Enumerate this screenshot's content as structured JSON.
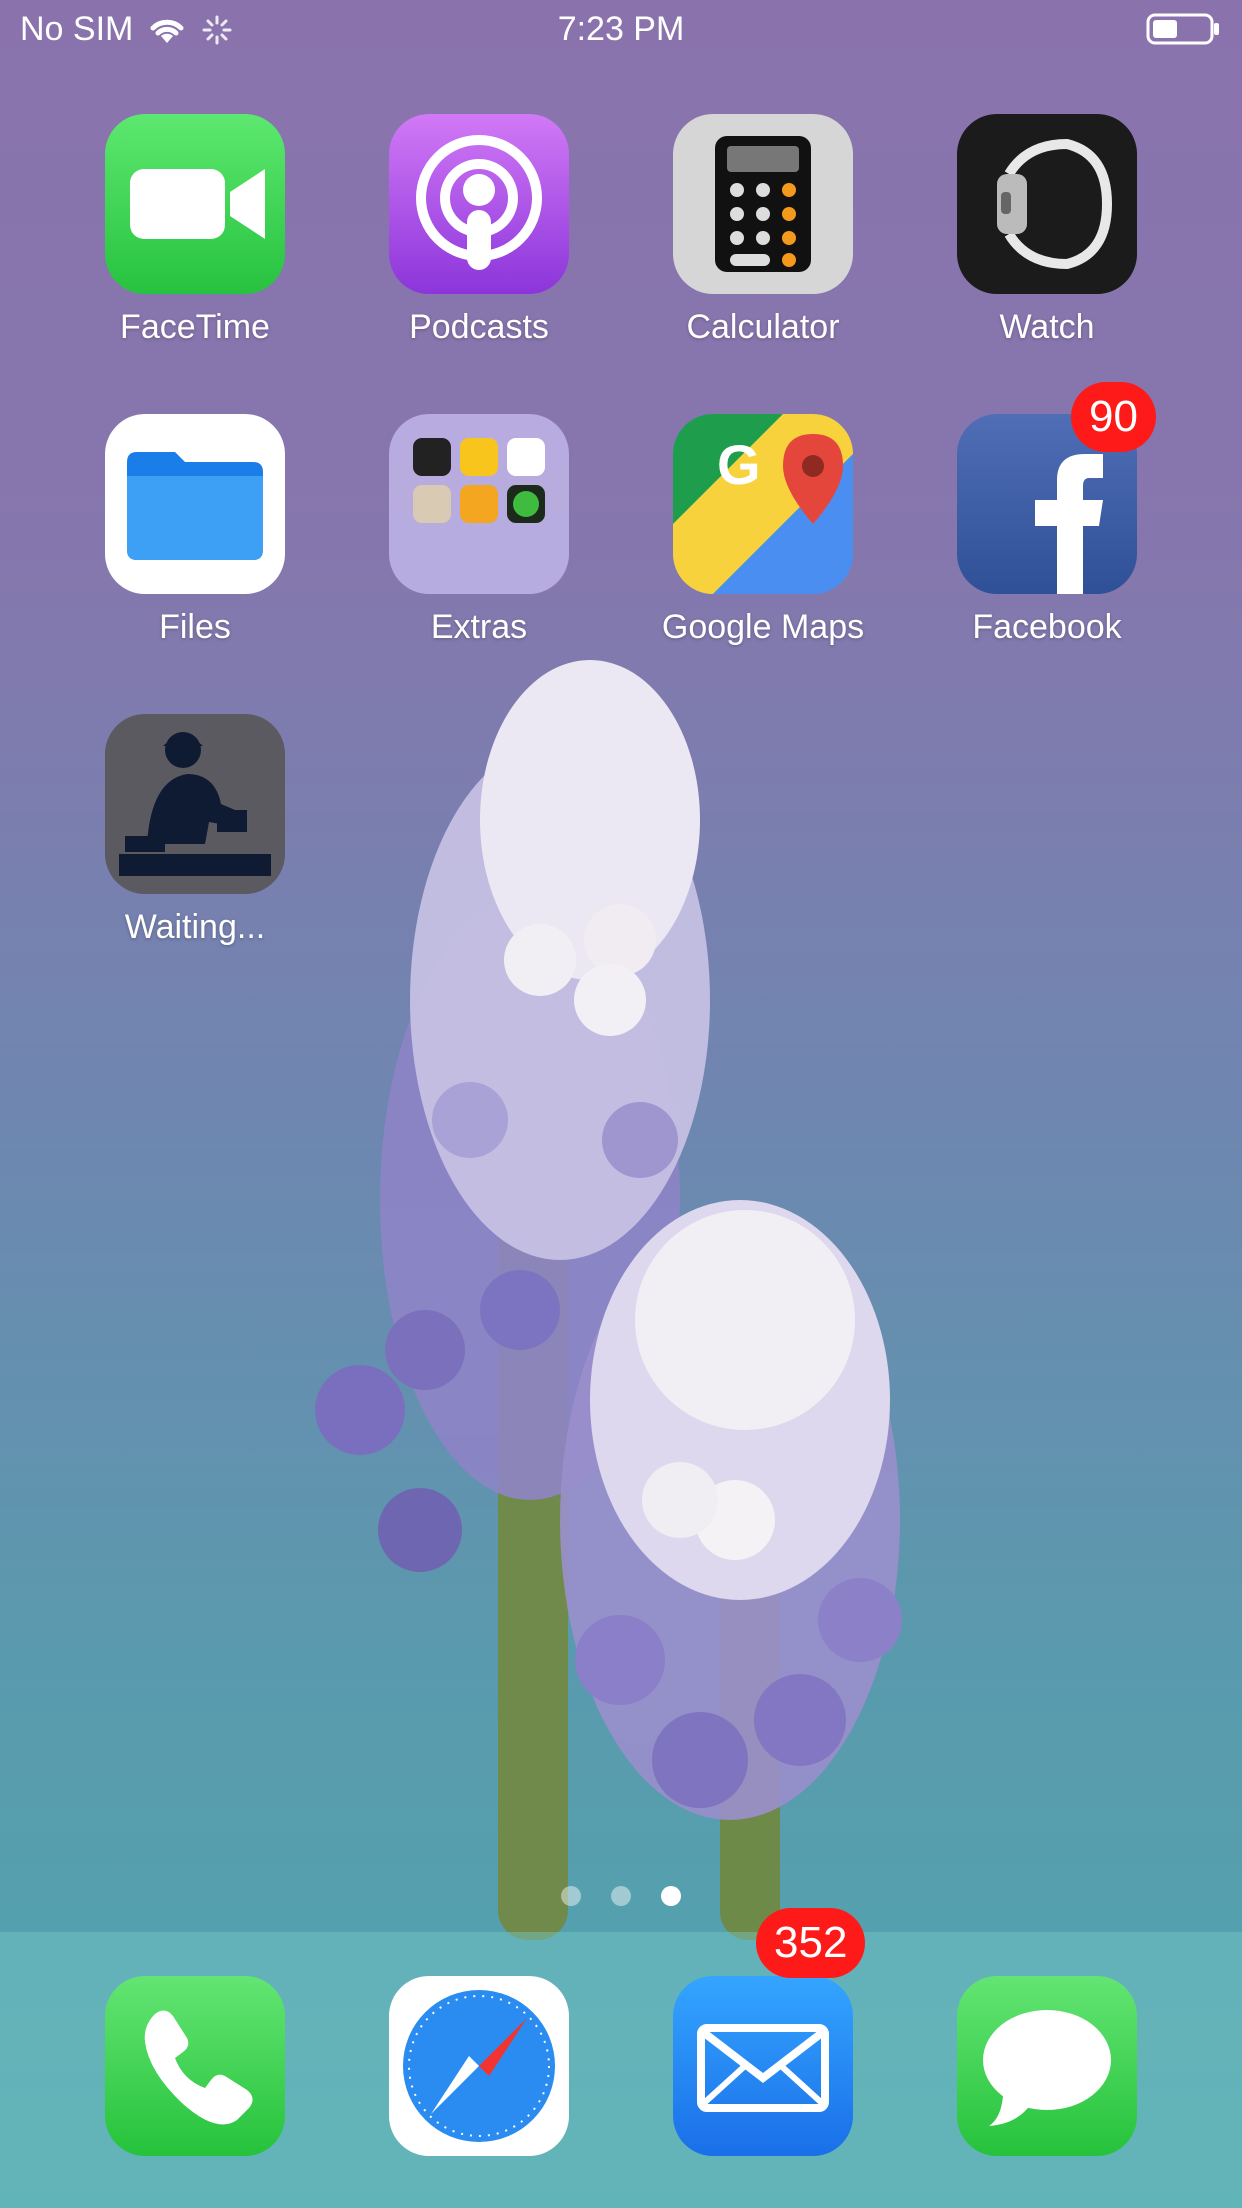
{
  "status_bar": {
    "carrier": "No SIM",
    "time": "7:23 PM",
    "icons": [
      "wifi-icon",
      "activity-spinner-icon",
      "battery-icon"
    ]
  },
  "apps": [
    {
      "label": "FaceTime",
      "icon": "facetime-icon"
    },
    {
      "label": "Podcasts",
      "icon": "podcasts-icon"
    },
    {
      "label": "Calculator",
      "icon": "calculator-icon"
    },
    {
      "label": "Watch",
      "icon": "watch-icon"
    },
    {
      "label": "Files",
      "icon": "files-icon"
    },
    {
      "label": "Extras",
      "icon": "folder-icon"
    },
    {
      "label": "Google Maps",
      "icon": "google-maps-icon"
    },
    {
      "label": "Facebook",
      "icon": "facebook-icon",
      "badge": "90"
    },
    {
      "label": "Waiting...",
      "icon": "waiting-app-icon"
    }
  ],
  "pages": {
    "count": 3,
    "active": 3
  },
  "dock": [
    {
      "name": "Phone",
      "icon": "phone-icon"
    },
    {
      "name": "Safari",
      "icon": "safari-icon"
    },
    {
      "name": "Mail",
      "icon": "mail-icon",
      "badge": "352"
    },
    {
      "name": "Messages",
      "icon": "messages-icon"
    }
  ],
  "colors": {
    "badge": "#ff1a1a",
    "facetime": "#34c759",
    "podcasts": "#a94ee6",
    "facebook": "#3b5998",
    "mail": "#1e8cf0"
  }
}
